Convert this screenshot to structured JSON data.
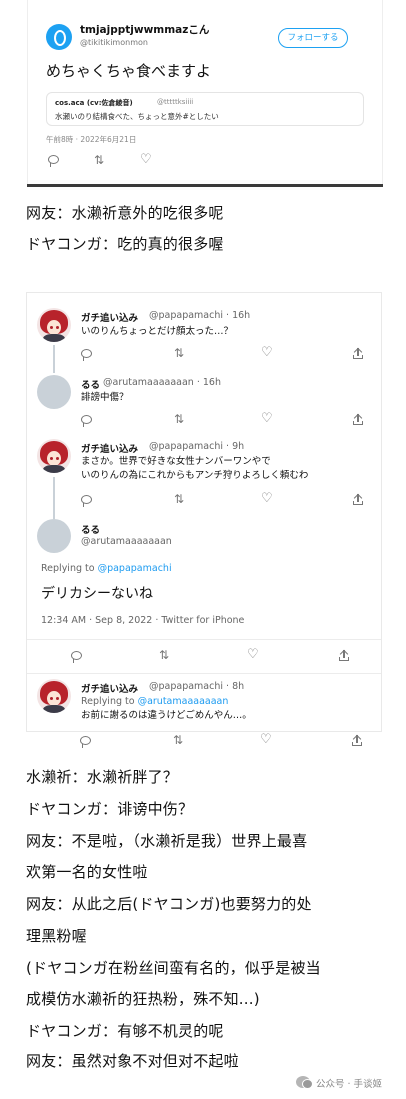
{
  "tweet1": {
    "name": "tmjajpptjwwmmazこん",
    "handle": "@tikitikimonmon",
    "follow_label": "フォローする",
    "text": "めちゃくちゃ食べますよ",
    "quote_name": "cos.aca (cv:佐倉綾音)",
    "quote_handle": "@tttttksiiii",
    "quote_text": "水瀬いのり結構食べた、ちょっと意外#としたい",
    "time": "午前8時 · 2022年6月21日"
  },
  "captions_top": [
    "网友：水濑祈意外的吃很多呢",
    "ドヤコンガ：吃的真的很多喔"
  ],
  "thread": {
    "t1": {
      "name": "ガチ追い込み",
      "meta": "@papapamachi · 16h",
      "text": "いのりんちょっとだけ顔太った…？"
    },
    "t2": {
      "name": "るる",
      "meta": "@arutamaaaaaaan · 16h",
      "text": "誹謗中傷？"
    },
    "t3": {
      "name": "ガチ追い込み",
      "meta": "@papapamachi · 9h",
      "text1": "まさか。世界で好きな女性ナンバーワンやで",
      "text2": "いのりんの為にこれからもアンチ狩りよろしく頼むわ"
    },
    "t4": {
      "name": "るる",
      "meta": "@arutamaaaaaaan",
      "replying_prefix": "Replying to ",
      "replying_to": "@papapamachi",
      "text": "デリカシーないね",
      "time": "12:34 AM · Sep 8, 2022 · Twitter for iPhone"
    },
    "t5": {
      "name": "ガチ追い込み",
      "meta": "@papapamachi · 8h",
      "replying_prefix": "Replying to ",
      "replying_to": "@arutamaaaaaaan",
      "text": "お前に謝るのは違うけどごめんやん…。"
    }
  },
  "captions_bottom": [
    "水濑祈：水濑祈胖了？",
    "ドヤコンガ：诽谤中伤？",
    "网友：不是啦，（水濑祈是我）世界上最喜",
    "欢第一名的女性啦",
    "网友：从此之后(ドヤコンガ)也要努力的处",
    "理黑粉喔",
    "(ドヤコンガ在粉丝间蛮有名的，似乎是被当",
    "成模仿水濑祈的狂热粉，殊不知...)",
    "ドヤコンガ：有够不机灵的呢",
    "网友：虽然对象不对但对不起啦"
  ],
  "watermark": "公众号 · 手谈姬",
  "icons": [
    "reply-icon",
    "retweet-icon",
    "like-icon",
    "share-icon"
  ]
}
